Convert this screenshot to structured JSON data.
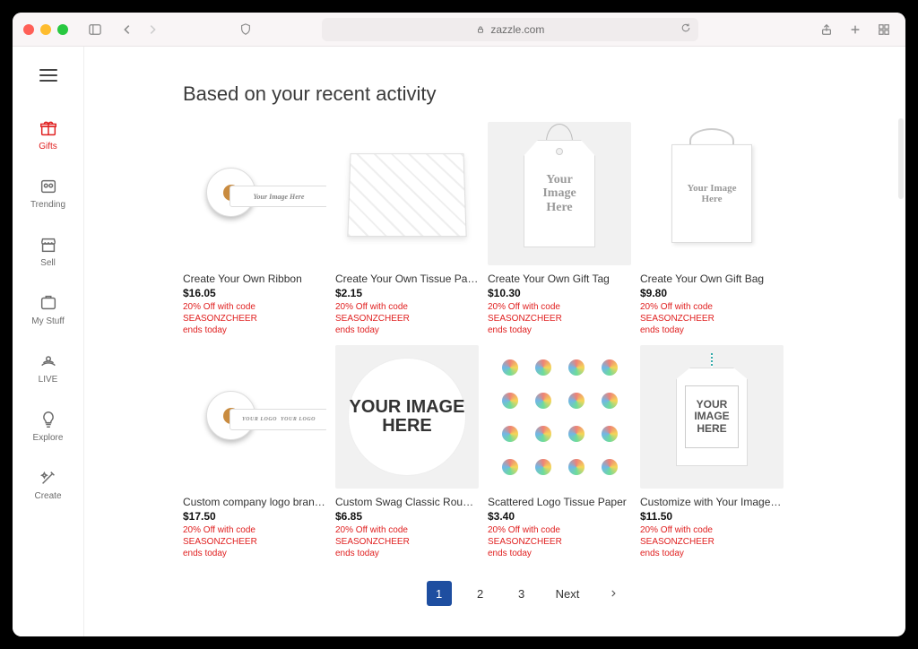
{
  "titlebar": {
    "url": "zazzle.com"
  },
  "sidebar": {
    "items": [
      {
        "label": "Gifts",
        "icon": "gift-icon",
        "active": true
      },
      {
        "label": "Trending",
        "icon": "trending-icon",
        "active": false
      },
      {
        "label": "Sell",
        "icon": "store-icon",
        "active": false
      },
      {
        "label": "My Stuff",
        "icon": "folder-icon",
        "active": false
      },
      {
        "label": "LIVE",
        "icon": "live-icon",
        "active": false
      },
      {
        "label": "Explore",
        "icon": "bulb-icon",
        "active": false
      },
      {
        "label": "Create",
        "icon": "wand-icon",
        "active": false
      }
    ]
  },
  "heading": "Based on your recent activity",
  "promo_line1": "20% Off with code SEASONZCHEER",
  "promo_line2": "ends today",
  "products": [
    {
      "title": "Create Your Own Ribbon",
      "price": "$16.05",
      "thumb": "ribbon",
      "ph": "Your Image Here"
    },
    {
      "title": "Create Your Own Tissue Paper",
      "price": "$2.15",
      "thumb": "tissue",
      "ph": ""
    },
    {
      "title": "Create Your Own Gift Tag",
      "price": "$10.30",
      "thumb": "tag",
      "ph": "Your Image Here"
    },
    {
      "title": "Create Your Own Gift Bag",
      "price": "$9.80",
      "thumb": "bag",
      "ph": "Your Image Here"
    },
    {
      "title": "Custom company logo branded business…",
      "price": "$17.50",
      "thumb": "ribbon2",
      "ph": "YOUR LOGO"
    },
    {
      "title": "Custom Swag Classic Round Sticker",
      "price": "$6.85",
      "thumb": "sticker",
      "ph": "YOUR IMAGE HERE"
    },
    {
      "title": "Scattered Logo Tissue Paper",
      "price": "$3.40",
      "thumb": "scatter",
      "ph": ""
    },
    {
      "title": "Customize with Your Image Gift Tags",
      "price": "$11.50",
      "thumb": "tag2",
      "ph": "YOUR IMAGE HERE"
    }
  ],
  "pagination": {
    "pages": [
      "1",
      "2",
      "3"
    ],
    "next": "Next",
    "active": "1"
  }
}
